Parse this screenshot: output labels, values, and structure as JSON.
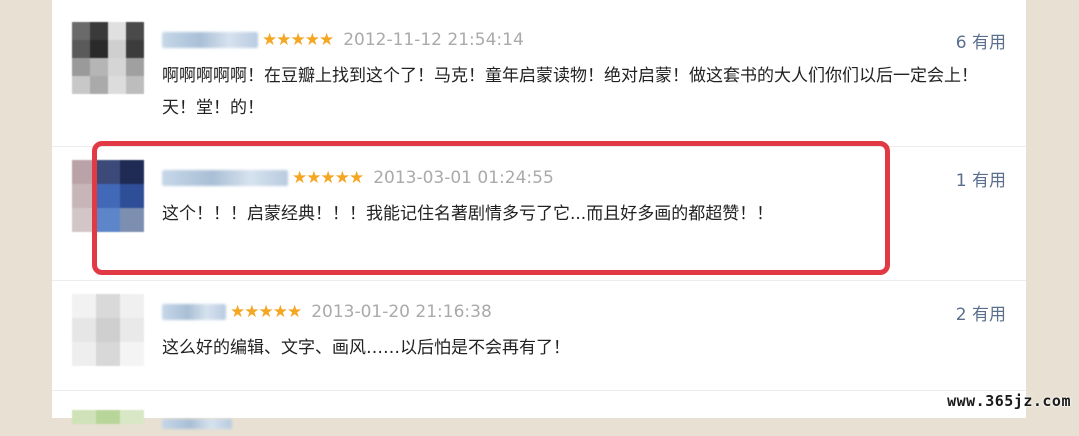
{
  "comments": [
    {
      "stars": "★★★★★",
      "date": "2012-11-12 21:54:14",
      "useful": "6 有用",
      "text": "啊啊啊啊啊！在豆瓣上找到这个了！马克！童年启蒙读物！绝对启蒙！做这套书的大人们你们以后一定会上！天！堂！的！"
    },
    {
      "stars": "★★★★★",
      "date": "2013-03-01 01:24:55",
      "useful": "1 有用",
      "text": "这个！！！启蒙经典！！！我能记住名著剧情多亏了它...而且好多画的都超赞！！"
    },
    {
      "stars": "★★★★★",
      "date": "2013-01-20 21:16:38",
      "useful": "2 有用",
      "text": "这么好的编辑、文字、画风……以后怕是不会再有了！"
    }
  ],
  "watermark": "www.365jz.com",
  "colors": {
    "star": "#f5a623",
    "highlight": "#e23a44",
    "useful": "#5b6f8c",
    "date": "#aaaaaa"
  }
}
